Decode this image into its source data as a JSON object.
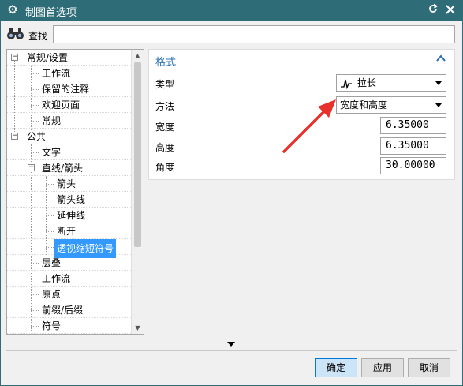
{
  "window": {
    "title": "制图首选项"
  },
  "search": {
    "label": "查找",
    "value": ""
  },
  "tree": {
    "items": [
      {
        "label": "常规/设置",
        "level": 0,
        "expanded": true
      },
      {
        "label": "工作流",
        "level": 1
      },
      {
        "label": "保留的注释",
        "level": 1
      },
      {
        "label": "欢迎页面",
        "level": 1
      },
      {
        "label": "常规",
        "level": 1
      },
      {
        "label": "公共",
        "level": 0,
        "expanded": true
      },
      {
        "label": "文字",
        "level": 1
      },
      {
        "label": "直线/箭头",
        "level": 1,
        "expanded": true
      },
      {
        "label": "箭头",
        "level": 2
      },
      {
        "label": "箭头线",
        "level": 2
      },
      {
        "label": "延伸线",
        "level": 2
      },
      {
        "label": "断开",
        "level": 2
      },
      {
        "label": "透视缩短符号",
        "level": 2,
        "selected": true
      },
      {
        "label": "层叠",
        "level": 1
      },
      {
        "label": "工作流",
        "level": 1
      },
      {
        "label": "原点",
        "level": 1
      },
      {
        "label": "前缀/后缀",
        "level": 1
      },
      {
        "label": "符号",
        "level": 1
      }
    ]
  },
  "panel": {
    "title": "格式",
    "type_label": "类型",
    "type_value": "拉长",
    "method_label": "方法",
    "method_value": "宽度和高度",
    "width_label": "宽度",
    "width_value": "6.35000",
    "height_label": "高度",
    "height_value": "6.35000",
    "angle_label": "角度",
    "angle_value": "30.00000"
  },
  "buttons": {
    "ok": "确定",
    "apply": "应用",
    "cancel": "取消"
  },
  "colors": {
    "titlebar": "#2e6c78",
    "accent": "#2a6fb5",
    "selection": "#3399ff",
    "annotation_arrow": "#e8312a"
  },
  "icons": {
    "window": "gear-icon",
    "search": "binoculars-icon",
    "reset": "refresh-icon",
    "close": "close-icon",
    "collapse": "chevron-up-icon",
    "type": "zigzag-icon"
  }
}
